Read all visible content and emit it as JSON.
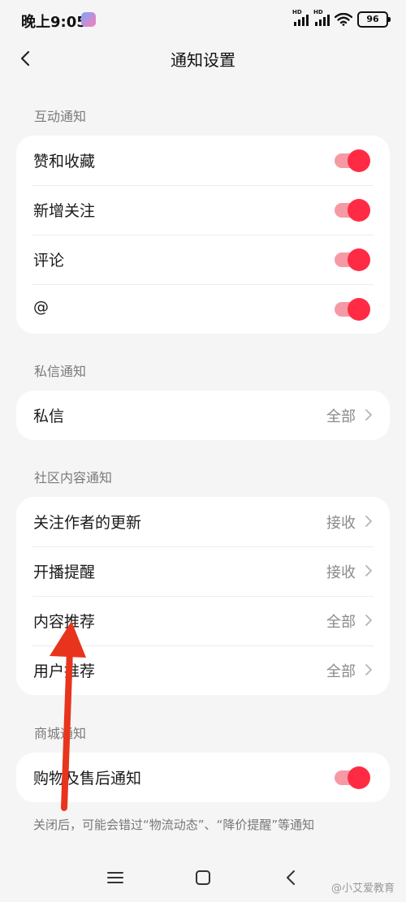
{
  "status_bar": {
    "time": "晚上9:05",
    "signal_tag": "HD",
    "battery": "96"
  },
  "header": {
    "title": "通知设置"
  },
  "sections": {
    "interaction": {
      "label": "互动通知",
      "items": [
        {
          "label": "赞和收藏",
          "toggle": true
        },
        {
          "label": "新增关注",
          "toggle": true
        },
        {
          "label": "评论",
          "toggle": true
        },
        {
          "label": "@",
          "toggle": true
        }
      ]
    },
    "messages": {
      "label": "私信通知",
      "items": [
        {
          "label": "私信",
          "value": "全部"
        }
      ]
    },
    "community": {
      "label": "社区内容通知",
      "items": [
        {
          "label": "关注作者的更新",
          "value": "接收"
        },
        {
          "label": "开播提醒",
          "value": "接收"
        },
        {
          "label": "内容推荐",
          "value": "全部"
        },
        {
          "label": "用户推荐",
          "value": "全部"
        }
      ]
    },
    "mall": {
      "label": "商城通知",
      "items": [
        {
          "label": "购物及售后通知",
          "toggle": true
        }
      ]
    }
  },
  "footer_note": "关闭后，可能会错过“物流动态”、“降价提醒”等通知",
  "watermark": "@小艾爱教育",
  "colors": {
    "accent": "#ff2b45",
    "track": "#f59aa4",
    "background": "#f5f5f5",
    "annotation_arrow": "#e8341c"
  },
  "icons": {
    "back": "chevron-left-icon",
    "chevron": "chevron-right-icon",
    "nav_menu": "menu-icon",
    "nav_home": "home-square-icon",
    "nav_back": "back-triangle-icon"
  }
}
